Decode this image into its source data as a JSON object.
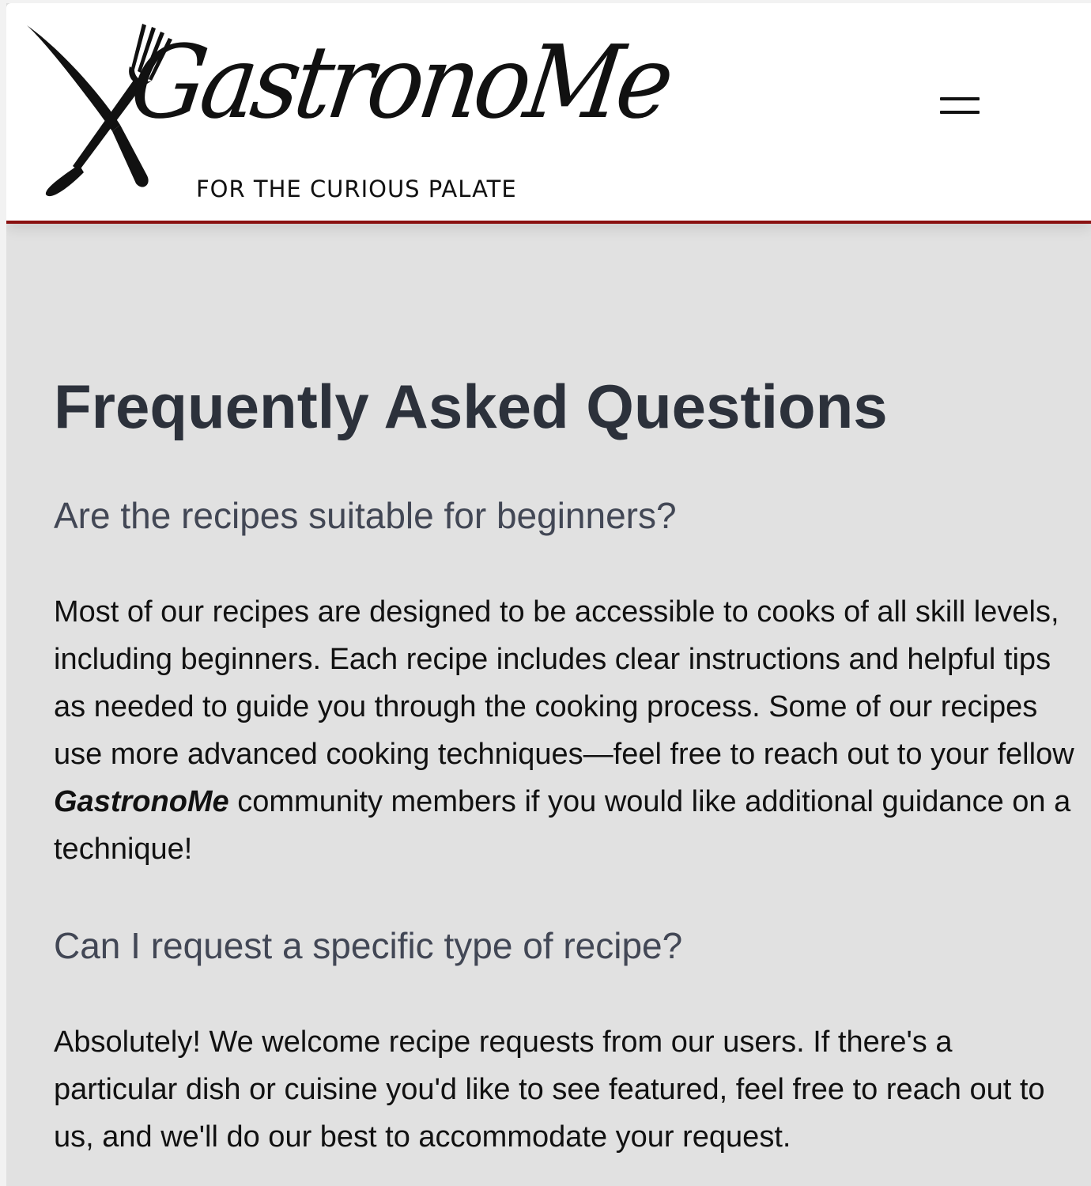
{
  "header": {
    "logo": {
      "wordmark": "GastronoMe",
      "tagline": "FOR THE CURIOUS PALATE",
      "icon": "fork-and-knife-icon"
    },
    "menu_icon": "hamburger-menu-icon"
  },
  "main": {
    "title": "Frequently Asked Questions",
    "faqs": [
      {
        "question": "Are the recipes suitable for beginners?",
        "answer_before": "Most of our recipes are designed to be accessible to cooks of all skill levels, including beginners. Each recipe includes clear instructions and helpful tips as needed to guide you through the cooking process. Some of our recipes use more advanced cooking techniques—feel free to reach out to your fellow ",
        "answer_brand": "GastronoMe",
        "answer_after": " community members if you would like additional guidance on a technique!"
      },
      {
        "question": "Can I request a specific type of recipe?",
        "answer": "Absolutely! We welcome recipe requests from our users. If there's a particular dish or cuisine you'd like to see featured, feel free to reach out to us, and we'll do our best to accommodate your request."
      }
    ]
  },
  "colors": {
    "header_border": "#8a1111",
    "page_background": "#e1e1e1",
    "title": "#2c313b",
    "question": "#424755",
    "body_text": "#111111"
  }
}
